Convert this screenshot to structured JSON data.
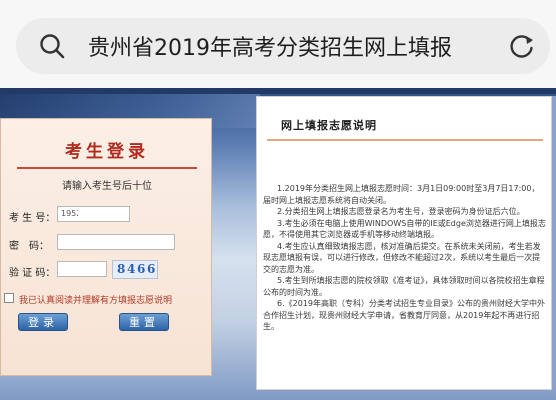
{
  "browser": {
    "address_text": "贵州省2019年高考分类招生网上填报"
  },
  "login": {
    "title": "考生登录",
    "hint": "请输入考生号后十位",
    "id_label": "考 生 号：",
    "id_prefix": "1952",
    "password_label": "密　码：",
    "code_label": "验 证 码：",
    "captcha_text": [
      "8",
      "4",
      "6",
      "6"
    ],
    "agree_text": "我已认真阅读并理解有方填报志愿说明",
    "login_button": "登录",
    "reset_button": "重置"
  },
  "info": {
    "title": "网上填报志愿说明",
    "items": [
      "1.2019年分类招生网上填报志愿时间：3月1日09:00时至3月7日17:00，届时网上填报志愿系统将自动关闭。",
      "2.分类招生网上填报志愿登录名为考生号，登录密码为身份证后六位。",
      "3.考生必须在电脑上使用WINDOWS自带的IE或Edge浏览器进行网上填报志愿，不得使用其它浏览器或手机等移动终端填报。",
      "4.考生应认真细致填报志愿，核对准确后提交。在系统未关闭前，考生若发现志愿填报有误，可以进行修改，但修改不能超过2次，系统以考生最后一次提交的志愿为准。",
      "5.考生到所填报志愿的院校领取《准考证》，具体领取时间以各院校招生章程公布的时间为准。",
      "6.《2019年高职（专科）分类考试招生专业目录》公布的贵州财经大学中外合作招生计划，现贵州财经大学申请，省教育厅同意，从2019年起不再进行招生。"
    ]
  },
  "colors": {
    "title_red": "#b12a1d",
    "button_blue": "#2d63a6",
    "header_rule": "#e2a97f"
  },
  "icons": {
    "search": "search-icon",
    "reload": "reload-icon"
  }
}
